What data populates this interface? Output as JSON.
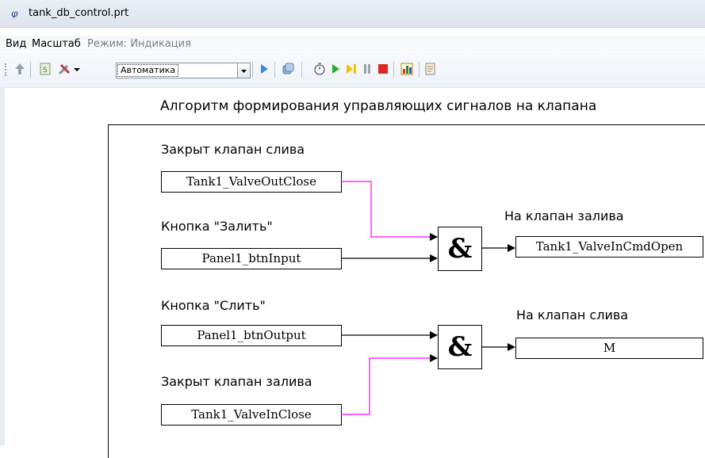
{
  "window": {
    "title": "tank_db_control.prt",
    "app_icon": "ip-logo-icon"
  },
  "menu": {
    "view": "Вид",
    "scale": "Масштаб",
    "mode": "Режим: Индикация"
  },
  "toolbar": {
    "mode_combo_value": "Автоматика",
    "icons": [
      "up-arrow-icon",
      "script-icon",
      "tools-icon",
      "dropdown-arrow-icon",
      "combo-dropdown-icon",
      "play-small-icon",
      "copy-icon",
      "stopwatch-icon",
      "run-icon",
      "step-icon",
      "pause-icon",
      "stop-icon",
      "chart-icon",
      "settings-icon"
    ]
  },
  "diagram": {
    "heading": "Алгоритм формирования управляющих сигналов на клапана",
    "labels": {
      "drain_closed": "Закрыт клапан слива",
      "btn_fill": "Кнопка \"Залить\"",
      "to_fill_valve": "На клапан залива",
      "btn_drain": "Кнопка \"Слить\"",
      "to_drain_valve": "На клапан слива",
      "fill_closed": "Закрыт клапан залива"
    },
    "inputs": {
      "valve_out_close": "Tank1_ValveOutClose",
      "btn_input": "Panel1_btnInput",
      "btn_output": "Panel1_btnOutput",
      "valve_in_close": "Tank1_ValveInClose"
    },
    "outputs": {
      "valve_in_cmd_open": "Tank1_ValveInCmdOpen",
      "m": "M"
    },
    "gate_symbol": "&",
    "colors": {
      "inverted_link": "#ff00ff",
      "link": "#000000"
    }
  }
}
